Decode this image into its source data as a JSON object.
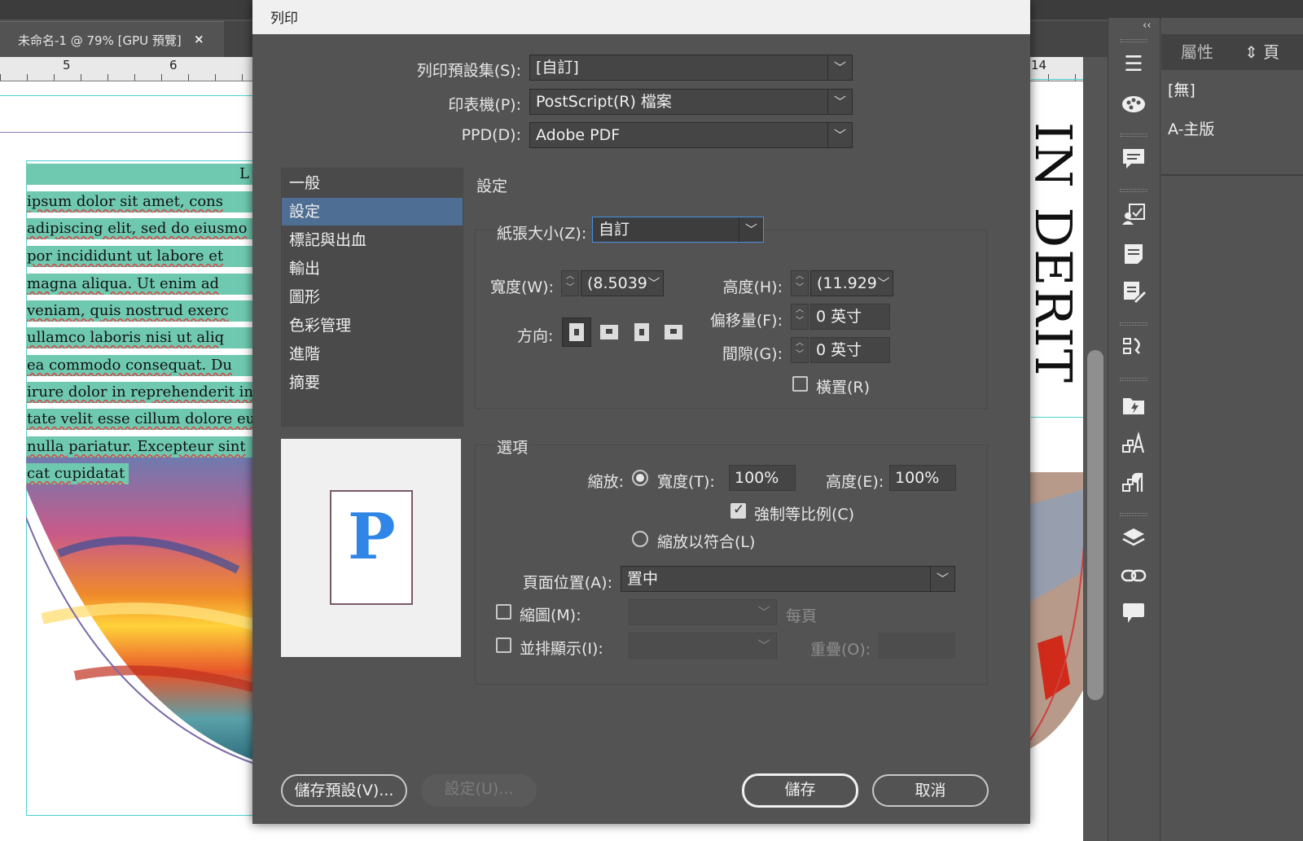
{
  "doc_tab": {
    "title": "未命名-1 @ 79% [GPU 預覽]",
    "close": "×"
  },
  "ruler": {
    "marks": [
      "5",
      "6",
      "14"
    ]
  },
  "page": {
    "lines": [
      "L",
      "ipsum dolor sit amet, cons",
      "adipiscing elit, sed do eiusmo",
      "por incididunt ut labore et",
      "magna aliqua. Ut enim ad",
      "veniam, quis nostrud exerc",
      "ullamco laboris nisi ut aliq",
      "ea commodo consequat. Du",
      "irure dolor in reprehenderit in",
      "tate velit esse cillum dolore eu",
      "nulla pariatur. Excepteur sint",
      "cat cupidatat"
    ],
    "vertical_title": "IN DERIT"
  },
  "right_panel": {
    "collapse": "‹‹",
    "tab_properties": "屬性",
    "tab_pages": "⇕ 頁",
    "none_item": "[無]",
    "master_item": "A-主版"
  },
  "tools": {
    "icons": [
      "menu-icon",
      "color-palette-icon",
      "comment-icon",
      "assign-icon",
      "notes-icon",
      "edit-notes-icon",
      "text-wrap-icon",
      "cc-library-icon",
      "character-styles-icon",
      "paragraph-styles-icon",
      "layers-icon",
      "links-icon",
      "speech-bubble-icon"
    ]
  },
  "dialog": {
    "title": "列印",
    "preset_label": "列印預設集(S):",
    "preset_value": "[自訂]",
    "printer_label": "印表機(P):",
    "printer_value": "PostScript(R) 檔案",
    "ppd_label": "PPD(D):",
    "ppd_value": "Adobe PDF",
    "categories": [
      "一般",
      "設定",
      "標記與出血",
      "輸出",
      "圖形",
      "色彩管理",
      "進階",
      "摘要"
    ],
    "selected_category": "設定",
    "preview_letter": "P",
    "settings": {
      "heading": "設定",
      "paper_size_label": "紙張大小(Z):",
      "paper_size_value": "自訂",
      "width_label": "寬度(W):",
      "width_value": "(8.5039",
      "height_label": "高度(H):",
      "height_value": "(11.929",
      "offset_label": "偏移量(F):",
      "offset_value": "0 英寸",
      "gap_label": "間隙(G):",
      "gap_value": "0 英寸",
      "orientation_label": "方向:",
      "transverse_label": "橫置(R)",
      "transverse_checked": false
    },
    "options": {
      "heading": "選項",
      "scale_label": "縮放:",
      "scale_width_label": "寬度(T):",
      "scale_width_value": "100%",
      "scale_height_label": "高度(E):",
      "scale_height_value": "100%",
      "constrain_label": "強制等比例(C)",
      "constrain_checked": true,
      "scale_to_fit_label": "縮放以符合(L)",
      "page_position_label": "頁面位置(A):",
      "page_position_value": "置中",
      "thumbnails_label": "縮圖(M):",
      "per_page_label": "每頁",
      "tile_label": "並排顯示(I):",
      "overlap_label": "重疊(O):"
    },
    "buttons": {
      "save_preset": "儲存預設(V)...",
      "setup": "設定(U)...",
      "save": "儲存",
      "cancel": "取消"
    }
  }
}
